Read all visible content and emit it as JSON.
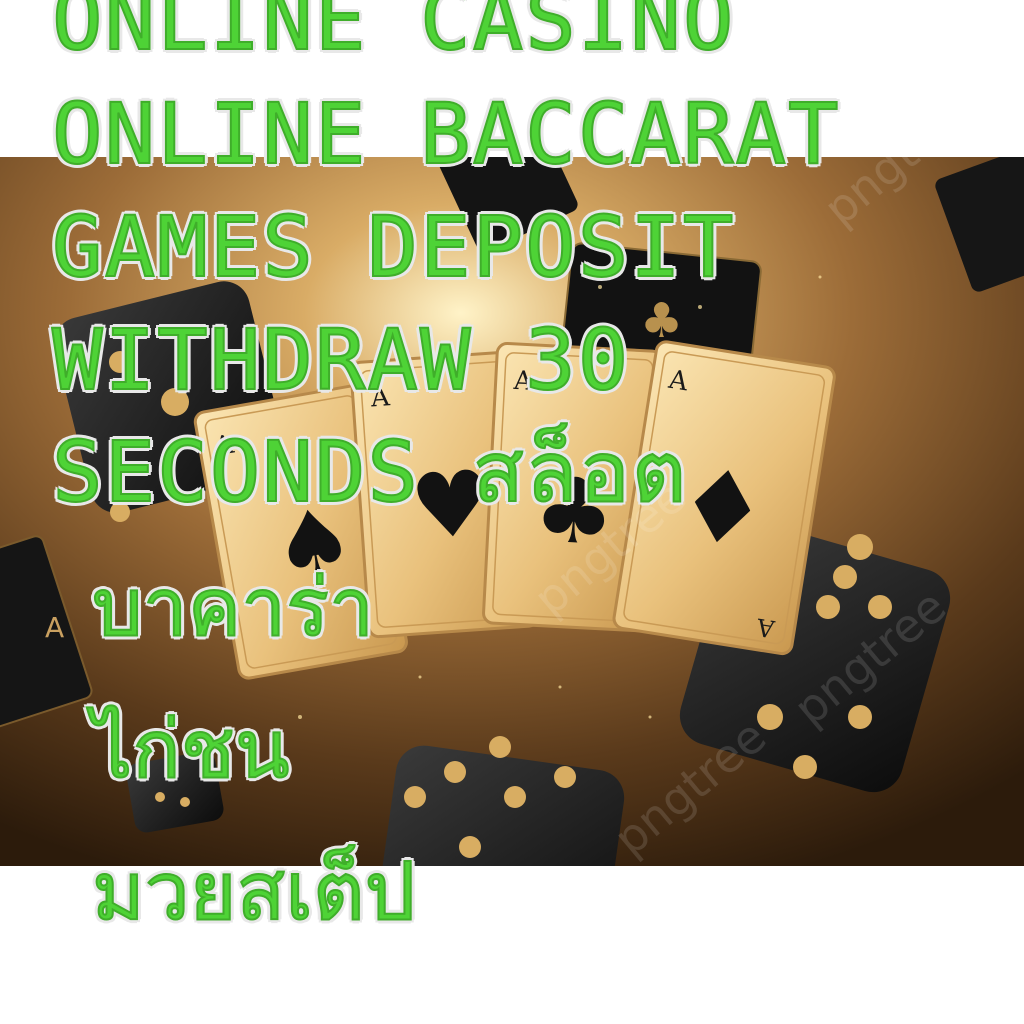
{
  "headline": {
    "line1": "ONLINE CASINO",
    "line2": "ONLINE BACCARAT",
    "line3": "GAMES DEPOSIT",
    "line4": "WITHDRAW 30",
    "line5": "SECONDS สล็อต"
  },
  "categories": {
    "baccarat": "บาคาร่า",
    "cockfight": "ไก่ชน",
    "muay_step": "มวยสเต็ป"
  },
  "image": {
    "cards": [
      {
        "rank": "A",
        "suit": "spade"
      },
      {
        "rank": "A",
        "suit": "heart"
      },
      {
        "rank": "A",
        "suit": "club"
      },
      {
        "rank": "A",
        "suit": "diamond"
      }
    ],
    "watermark": "pngtree"
  },
  "colors": {
    "text_green": "#4ed336",
    "text_outline": "#e8e8e8",
    "gold": "#d8ad62",
    "card_face": "#f0cf8e",
    "dice": "#1a1a1a",
    "background_dark": "#3a2410"
  }
}
